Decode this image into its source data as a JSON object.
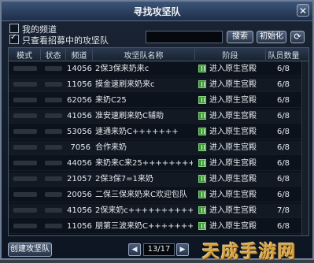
{
  "window": {
    "title": "寻找攻坚队",
    "close_label": "✕"
  },
  "filters": {
    "my_channel": {
      "label": "我的频道",
      "checked": false
    },
    "recruiting_only": {
      "label": "只查看招募中的攻坚队",
      "checked": true
    },
    "search_value": ""
  },
  "buttons": {
    "search": "搜索",
    "reset": "初始化",
    "refresh": "⟳",
    "create_team": "创建攻坚队"
  },
  "table": {
    "columns": [
      "模式",
      "状态",
      "频道",
      "攻坚队名称",
      "阶段",
      "队员数量"
    ],
    "rows": [
      {
        "channel": "14056",
        "name": "2保3保来奶来c",
        "stage": "进入原生宫殿",
        "members": "6/8"
      },
      {
        "channel": "11056",
        "name": "摸金速刷来奶来c",
        "stage": "进入原生宫殿",
        "members": "6/8"
      },
      {
        "channel": "62056",
        "name": "来奶C25",
        "stage": "进入原生宫殿",
        "members": "6/8"
      },
      {
        "channel": "41056",
        "name": "准安速刷来奶C辅助",
        "stage": "进入原生宫殿",
        "members": "6/8"
      },
      {
        "channel": "53056",
        "name": "速通来奶C+++++++",
        "stage": "进入原生宫殿",
        "members": "6/8"
      },
      {
        "channel": "7056",
        "name": "合作来奶",
        "stage": "进入原生宫殿",
        "members": "6/8"
      },
      {
        "channel": "44056",
        "name": "来奶来C来25++++++++++",
        "stage": "进入原生宫殿",
        "members": "6/8"
      },
      {
        "channel": "21057",
        "name": "2保3保7=1来奶",
        "stage": "进入原生宫殿",
        "members": "6/8"
      },
      {
        "channel": "20056",
        "name": "二保三保来奶来C欢迎包队",
        "stage": "进入原生宫殿",
        "members": "6/8"
      },
      {
        "channel": "41056",
        "name": "2保来奶c+++++++++++++",
        "stage": "进入原生宫殿",
        "members": "7/8"
      },
      {
        "channel": "11056",
        "name": "朋第三波来奶C++++++++",
        "stage": "进入原生宫殿",
        "members": "6/8"
      }
    ]
  },
  "pager": {
    "prev": "◀",
    "next": "▶",
    "page": "13/17"
  },
  "watermark": "天成手游网",
  "colors": {
    "stage_icon": "#3f9a3a",
    "title_bar": "#2d4364"
  },
  "icons": {
    "stage": "green-status-icon",
    "refresh": "refresh-icon",
    "close": "close-icon"
  }
}
